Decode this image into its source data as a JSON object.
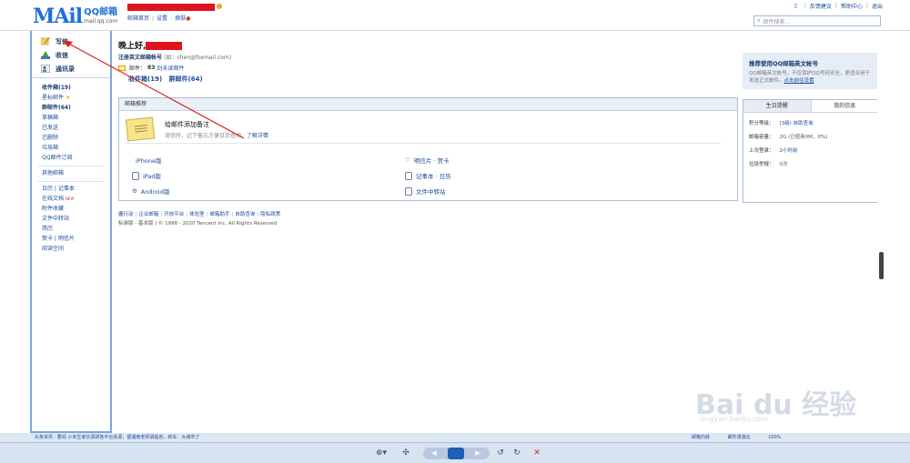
{
  "header": {
    "logo_mail": "MAil",
    "logo_qq": "QQ邮箱",
    "logo_domain": "mail.qq.com",
    "nav": [
      "邮箱首页",
      "设置",
      "换肤"
    ],
    "right_links": [
      "反馈建议",
      "帮助中心",
      "退出"
    ],
    "search_placeholder": "邮件搜索..."
  },
  "sidebar": {
    "quick": [
      {
        "label": "写信",
        "icon": "pencil-icon"
      },
      {
        "label": "收信",
        "icon": "inbox-icon"
      },
      {
        "label": "通讯录",
        "icon": "contacts-icon"
      }
    ],
    "folders": [
      {
        "label": "收件箱(19)",
        "bold": true
      },
      {
        "label": "星标邮件",
        "star": "★"
      },
      {
        "label": "群邮件(64)",
        "bold": true
      },
      {
        "label": "草稿箱"
      },
      {
        "label": "已发送"
      },
      {
        "label": "已删除"
      },
      {
        "label": "垃圾箱"
      },
      {
        "label": "QQ邮件订阅"
      }
    ],
    "other": "其他邮箱",
    "tools": [
      {
        "label": "日历 | 记事本"
      },
      {
        "label": "在线文档",
        "new": "NEW"
      },
      {
        "label": "附件收藏"
      },
      {
        "label": "文件中转站"
      },
      {
        "label": "简历"
      },
      {
        "label": "贺卡 | 明信片"
      },
      {
        "label": "阅读空间"
      }
    ]
  },
  "main": {
    "greeting": "晚上好,",
    "register_label": "注册英文邮箱帐号",
    "register_example": "(如：chen@foxmail.com)",
    "mail_prefix": "邮件：",
    "mail_count": "83",
    "mail_suffix": "封未读邮件",
    "inbox_count": "收件箱(19)",
    "group_count": "群邮件(64)",
    "recommend_title": "推荐使用QQ邮箱英文帐号",
    "recommend_desc": "QQ邮箱英文帐号，不仅保护QQ号码安全，更适合用于发送正式邮件。",
    "recommend_link": "点击前往设置",
    "panel_title": "邮箱推荐",
    "tip_title": "给邮件添加备注",
    "tip_desc": "读信时，记下备忘方便日后查阅。",
    "tip_link": "了解详情",
    "apps_left": [
      "iPhone版",
      "iPad版",
      "Android版"
    ],
    "apps_right": [
      "明信片 · 贺卡",
      "记事本 · 日历",
      "文件中转站"
    ],
    "side_tabs": [
      "生日提醒",
      "我的信息"
    ],
    "info": [
      {
        "label": "积分等级：",
        "value": "(3级) 自助查询"
      },
      {
        "label": "邮箱容量：",
        "value": "2G (已使用0M，0%)"
      },
      {
        "label": "上次登录：",
        "value": "2小时前"
      },
      {
        "label": "垃圾举报：",
        "value": "0次"
      }
    ],
    "footer_links": [
      "握行动",
      "企业邮箱",
      "开放平台",
      "体验室",
      "邮箱助手",
      "自助查询",
      "隐私政策"
    ],
    "footer_copy": "标准版 - 基本版 | © 1998 - 2020 Tencent Inc. All Rights Reserved"
  },
  "statusbar": {
    "left": "头条资讯  ·  要闻  小米生家长调研各平台资源，暨湖南老师谓提省，新车：大城市了",
    "right": [
      "邮箱内转",
      "邮件漫游云",
      "100%"
    ]
  },
  "watermark": {
    "text": "Bai du 经验",
    "sub": "jingyan.baidu.com"
  }
}
